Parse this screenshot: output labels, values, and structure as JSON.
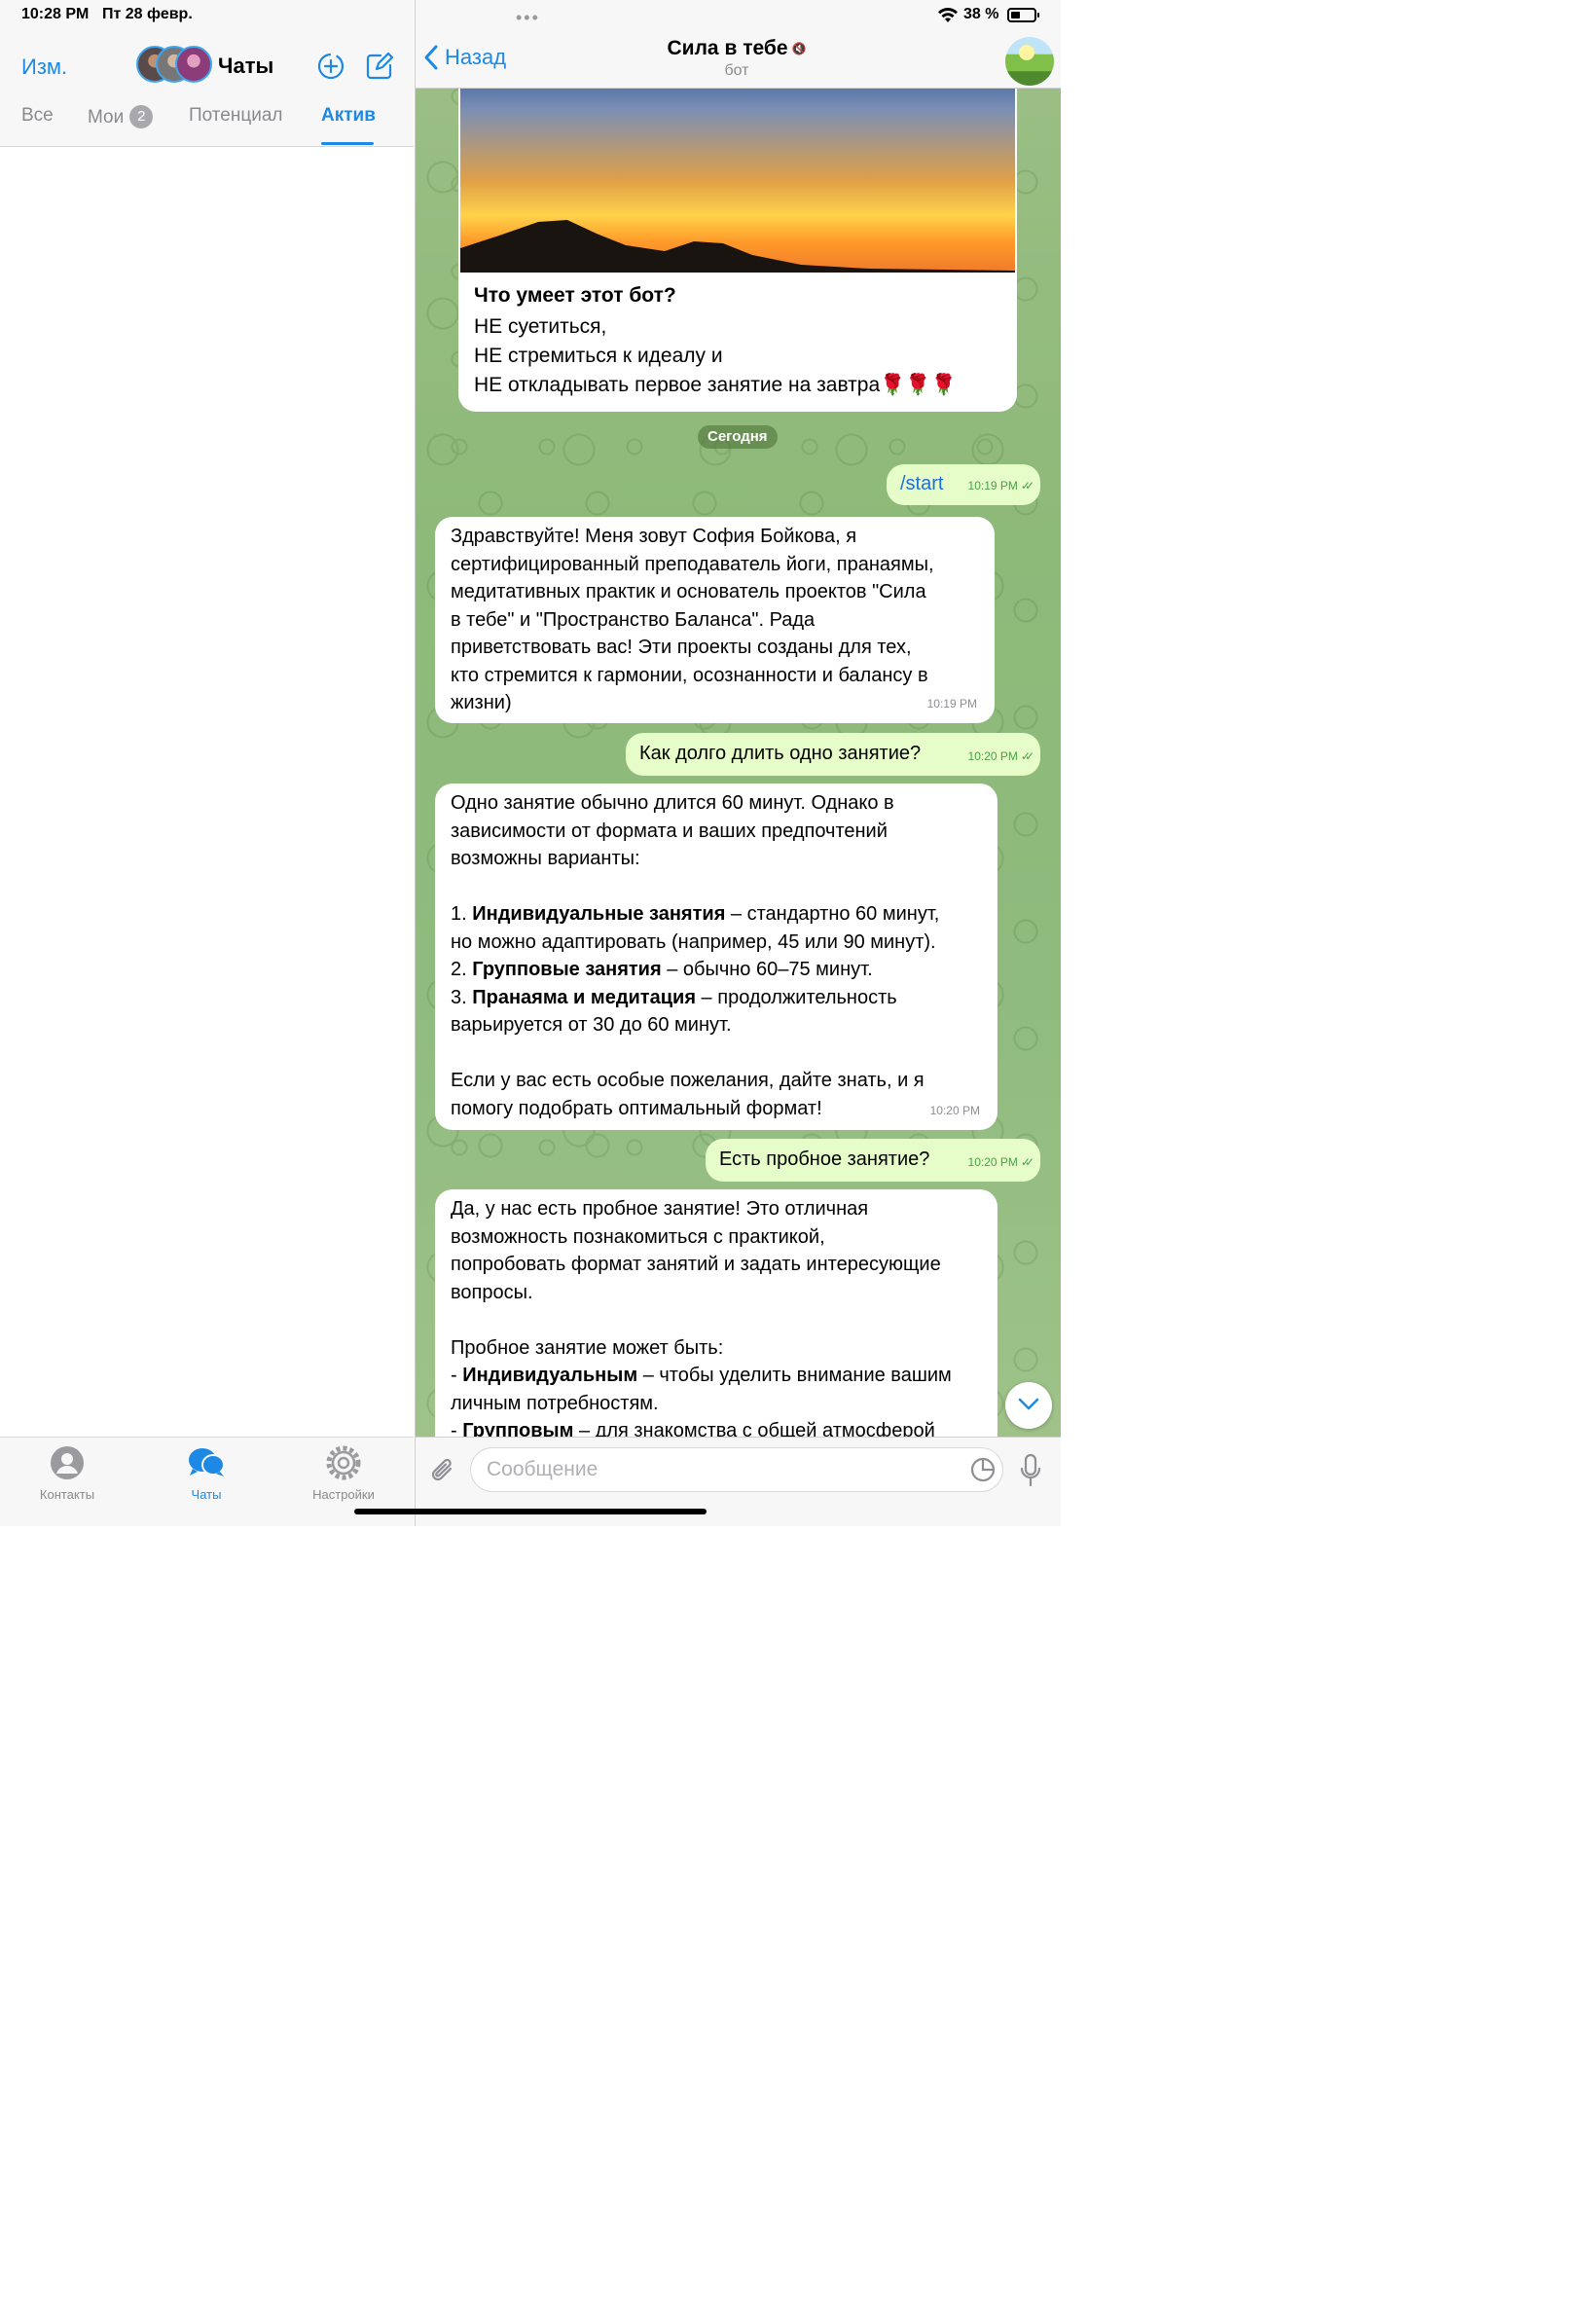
{
  "status": {
    "time": "10:28 PM",
    "date": "Пт 28 февр.",
    "battery": "38 %"
  },
  "left": {
    "edit": "Изм.",
    "title": "Чаты",
    "tabs": [
      {
        "label": "Все"
      },
      {
        "label": "Мои",
        "badge": "2"
      },
      {
        "label": "Потенциал"
      },
      {
        "label": "Актив",
        "active": true
      }
    ],
    "bottom": [
      {
        "label": "Контакты",
        "icon": "person-circle-icon"
      },
      {
        "label": "Чаты",
        "icon": "chat-bubbles-icon",
        "active": true
      },
      {
        "label": "Настройки",
        "icon": "gear-icon"
      }
    ]
  },
  "chat": {
    "back": "Назад",
    "title": "Сила в тебе",
    "subtitle": "бот",
    "intro": {
      "title": "Что умеет этот бот?",
      "lines": [
        "НЕ суетиться,",
        "НЕ стремиться к идеалу и",
        "НЕ откладывать первое занятие на завтра🌹🌹🌹"
      ]
    },
    "date_divider": "Сегодня",
    "messages": [
      {
        "dir": "out",
        "text": "/start",
        "time": "10:19 PM"
      },
      {
        "dir": "in",
        "time": "10:19 PM",
        "lines": [
          "Здравствуйте! Меня зовут София Бойкова, я",
          "сертифицированный преподаватель йоги, пранаямы,",
          "медитативных практик и основатель проектов \"Сила",
          "в тебе\" и \"Пространство Баланса\". Рада",
          "приветствовать вас! Эти проекты созданы для тех,",
          "кто стремится к гармонии, осознанности и балансу в",
          "жизни)"
        ]
      },
      {
        "dir": "out",
        "text": "Как долго длить одно занятие?",
        "time": "10:20 PM"
      },
      {
        "dir": "in",
        "time": "10:20 PM",
        "lines": [
          "Одно занятие обычно длится 60 минут. Однако в",
          "зависимости от формата и ваших предпочтений",
          "возможны варианты:",
          "",
          "1. **Индивидуальные занятия** – стандартно 60 минут,",
          "но можно адаптировать (например, 45 или 90 минут).",
          "2. **Групповые занятия** – обычно 60–75 минут.",
          "3. **Пранаяма и медитация** – продолжительность",
          "варьируется от 30 до 60 минут.",
          "",
          "Если у вас есть особые пожелания, дайте знать, и я",
          "помогу подобрать оптимальный формат!"
        ]
      },
      {
        "dir": "out",
        "text": "Есть пробное занятие?",
        "time": "10:20 PM"
      },
      {
        "dir": "in",
        "lines": [
          "Да, у нас есть пробное занятие! Это отличная",
          "возможность познакомиться с практикой,",
          "попробовать формат занятий и задать интересующие",
          "вопросы.",
          "",
          "Пробное занятие может быть:",
          "- **Индивидуальным** – чтобы уделить внимание вашим",
          "личным потребностям.",
          "- **Групповым** – для знакомства с общей атмосферой"
        ]
      }
    ],
    "composer_placeholder": "Сообщение"
  }
}
